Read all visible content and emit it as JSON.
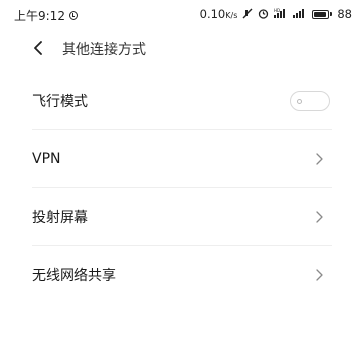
{
  "status_bar": {
    "time": "上午9:12",
    "network_speed": "0.10",
    "network_unit": "K/s",
    "battery": "88",
    "battery_level": 0.88,
    "icons": [
      "sync-icon",
      "mute-icon",
      "alarm-icon",
      "signal-icon",
      "signal-icon",
      "battery-icon"
    ]
  },
  "header": {
    "title": "其他连接方式",
    "back_icon": "chevron-left-icon"
  },
  "settings": {
    "items": [
      {
        "label": "飞行模式",
        "control": "toggle",
        "state": "off"
      },
      {
        "label": "VPN",
        "control": "chevron"
      },
      {
        "label": "投射屏幕",
        "control": "chevron"
      },
      {
        "label": "无线网络共享",
        "control": "chevron"
      }
    ]
  }
}
